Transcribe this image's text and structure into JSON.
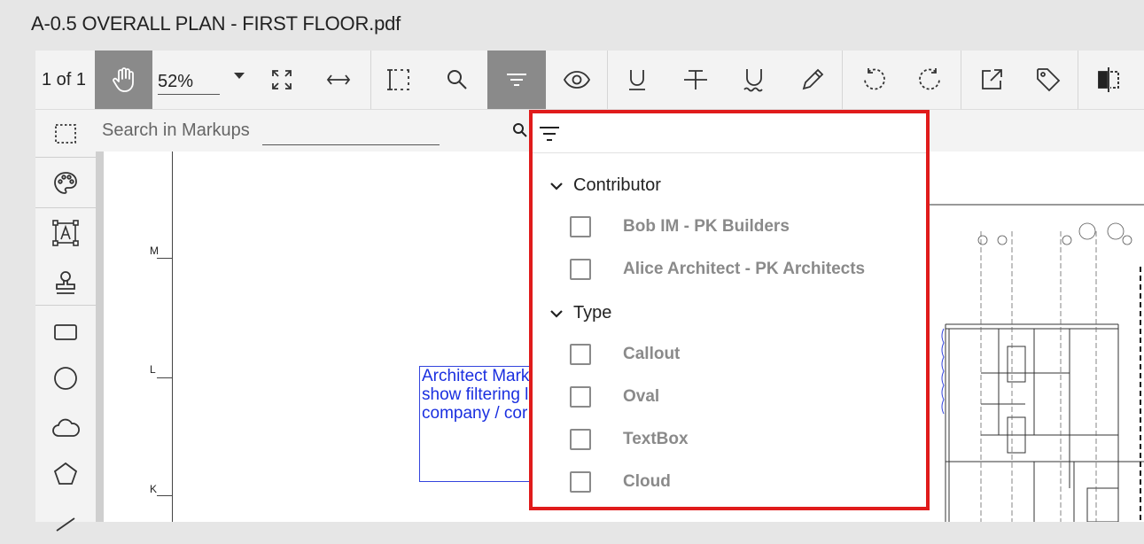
{
  "document": {
    "title": "A-0.5 OVERALL PLAN - FIRST FLOOR.pdf"
  },
  "toolbar": {
    "page_indicator": "1 of 1",
    "zoom_value": "52%",
    "tools": [
      "pan-hand-icon",
      "fit-page-icon",
      "fit-width-icon",
      "marquee-select-icon",
      "search-icon",
      "filter-icon",
      "visibility-eye-icon",
      "underline-icon",
      "strikethrough-icon",
      "squiggly-underline-icon",
      "pencil-icon",
      "rotate-left-icon",
      "rotate-right-icon",
      "open-external-icon",
      "tag-icon",
      "compare-icon"
    ]
  },
  "left_tools": [
    "marquee-icon",
    "palette-icon",
    "text-box-icon",
    "stamp-icon",
    "rectangle-icon",
    "circle-icon",
    "cloud-icon",
    "polygon-icon",
    "line-icon"
  ],
  "markups_search": {
    "placeholder": "Search in Markups"
  },
  "ruler": {
    "labels": [
      "M",
      "L",
      "K"
    ]
  },
  "markup": {
    "text": "Architect Mark\nshow filtering l\ncompany / cor"
  },
  "filter_panel": {
    "groups": [
      {
        "label": "Contributor",
        "options": [
          "Bob IM - PK Builders",
          "Alice Architect - PK Architects"
        ]
      },
      {
        "label": "Type",
        "options": [
          "Callout",
          "Oval",
          "TextBox",
          "Cloud"
        ]
      }
    ]
  },
  "colors": {
    "highlight_border": "#e01b1b",
    "active_tool_bg": "#8a8a8a",
    "markup_blue": "#1a2fe0"
  }
}
